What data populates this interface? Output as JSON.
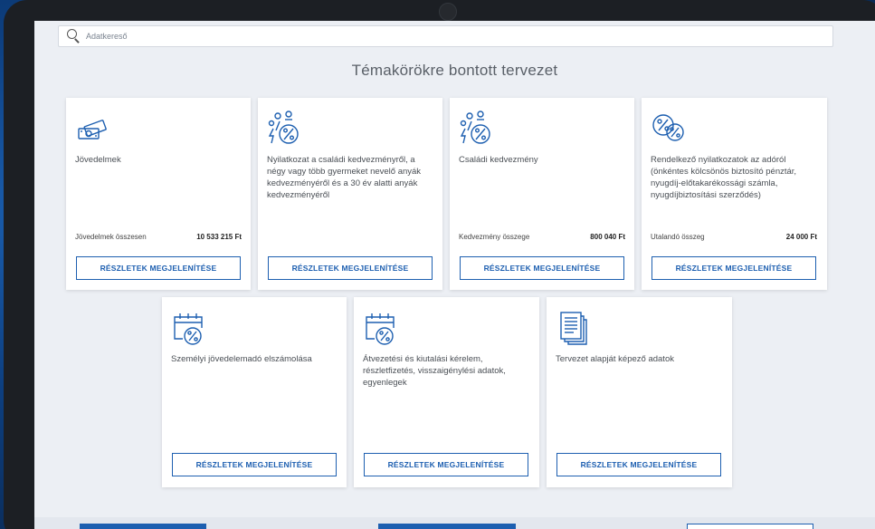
{
  "search": {
    "placeholder": "Adatkereső"
  },
  "page": {
    "title": "Témakörökre bontott tervezet"
  },
  "detail_label": "RÉSZLETEK MEGJELENÍTÉSE",
  "colors": {
    "accent": "#1d5fb0",
    "icon": "#1d5fb0",
    "background": "#eceff4"
  },
  "cards": [
    {
      "icon": "money-icon",
      "title": "Jövedelmek",
      "sum_label": "Jövedelmek összesen",
      "sum_value": "10 533 215 Ft",
      "button": "RÉSZLETEK MEGJELENÍTÉSE"
    },
    {
      "icon": "family-percent-icon",
      "title": "Nyilatkozat a családi kedvezményről, a négy vagy több gyermeket nevelő anyák kedvezményéről és a 30 év alatti anyák kedvezményéről",
      "sum_label": "",
      "sum_value": "",
      "button": "RÉSZLETEK MEGJELENÍTÉSE"
    },
    {
      "icon": "family-percent-icon",
      "title": "Családi kedvezmény",
      "sum_label": "Kedvezmény összege",
      "sum_value": "800 040 Ft",
      "button": "RÉSZLETEK MEGJELENÍTÉSE"
    },
    {
      "icon": "percent-badge-icon",
      "title": "Rendelkező nyilatkozatok az adóról (önkéntes kölcsönös biztosító pénztár, nyugdíj-előtakarékossági számla, nyugdíjbiztosítási szerződés)",
      "sum_label": "Utalandó összeg",
      "sum_value": "24 000 Ft",
      "button": "RÉSZLETEK MEGJELENÍTÉSE"
    },
    {
      "icon": "calendar-percent-icon",
      "title": "Személyi jövedelemadó elszámolása",
      "sum_label": "",
      "sum_value": "",
      "button": "RÉSZLETEK MEGJELENÍTÉSE"
    },
    {
      "icon": "calendar-percent-icon",
      "title": "Átvezetési és kiutalási kérelem, részletfizetés, visszaigénylési adatok, egyenlegek",
      "sum_label": "",
      "sum_value": "",
      "button": "RÉSZLETEK MEGJELENÍTÉSE"
    },
    {
      "icon": "documents-icon",
      "title": "Tervezet alapját képező adatok",
      "sum_label": "",
      "sum_value": "",
      "button": "RÉSZLETEK MEGJELENÍTÉSE"
    }
  ]
}
